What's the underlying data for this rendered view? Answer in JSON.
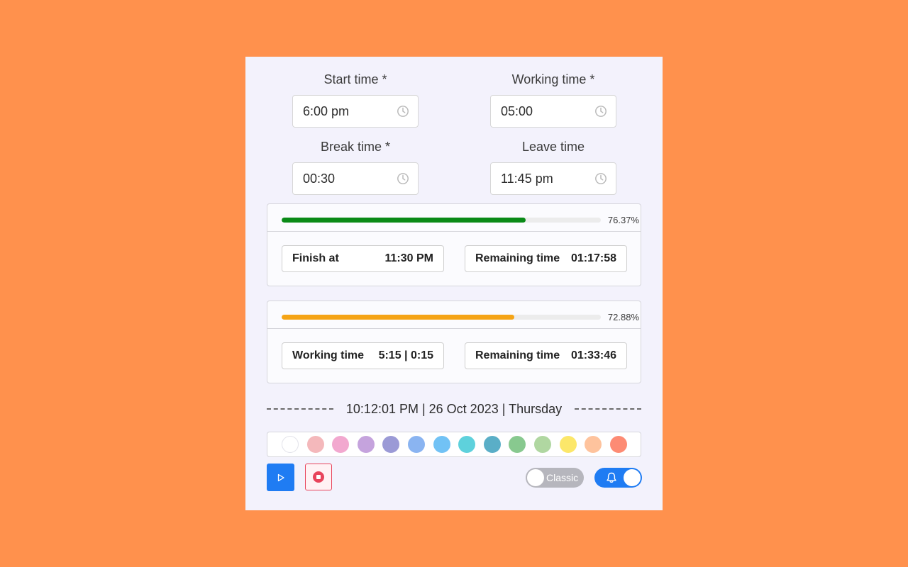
{
  "fields": {
    "start_time": {
      "label": "Start time *",
      "value": "6:00 pm"
    },
    "working_time": {
      "label": "Working time *",
      "value": "05:00"
    },
    "break_time": {
      "label": "Break time *",
      "value": "00:30"
    },
    "leave_time": {
      "label": "Leave time",
      "value": "11:45 pm"
    }
  },
  "progress1": {
    "percent_label": "76.37%",
    "fraction": 0.7637,
    "color": "#0a8a17",
    "left_chip": {
      "label": "Finish at",
      "value": "11:30 PM"
    },
    "right_chip": {
      "label": "Remaining time",
      "value": "01:17:58"
    }
  },
  "progress2": {
    "percent_label": "72.88%",
    "fraction": 0.7288,
    "color": "#f5a416",
    "left_chip": {
      "label": "Working time",
      "value": "5:15 | 0:15"
    },
    "right_chip": {
      "label": "Remaining time",
      "value": "01:33:46"
    }
  },
  "clock": {
    "text": "10:12:01 PM | 26 Oct 2023 | Thursday"
  },
  "swatches": [
    "#ffffff",
    "#f4b8bb",
    "#f2a8cf",
    "#c5a3dd",
    "#9b9ad6",
    "#8ab4f1",
    "#71c2f5",
    "#5ed1dc",
    "#5aaec7",
    "#88c98f",
    "#b0d7a1",
    "#fce76a",
    "#fec39d",
    "#fd8b74"
  ],
  "controls": {
    "play_icon": "play-icon",
    "stop_icon": "stop-icon",
    "classic_label": "Classic",
    "bell_icon": "bell-icon"
  }
}
